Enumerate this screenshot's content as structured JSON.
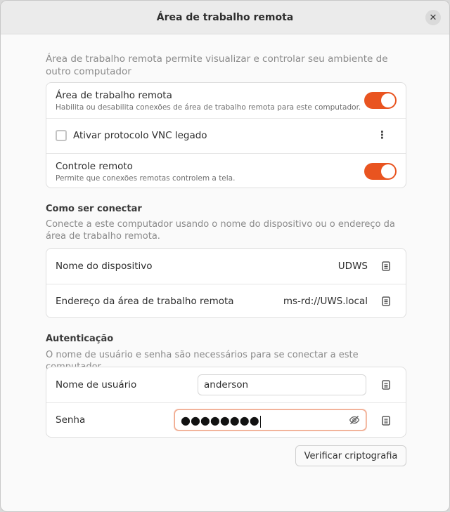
{
  "window": {
    "title": "Área de trabalho remota"
  },
  "intro": "Área de trabalho remota permite visualizar e controlar seu ambiente de outro computador",
  "settings": {
    "remote_desktop": {
      "title": "Área de trabalho remota",
      "subtitle": "Habilita ou desabilita conexões de área de trabalho remota para este computador.",
      "enabled": true
    },
    "vnc": {
      "label": "Ativar protocolo VNC legado",
      "checked": false,
      "menu_icon": "kebab-menu-icon"
    },
    "remote_control": {
      "title": "Controle remoto",
      "subtitle": "Permite que conexões remotas controlem a tela.",
      "enabled": true
    }
  },
  "connect": {
    "title": "Como ser conectar",
    "description": "Conecte a este computador usando o nome do dispositivo ou o endereço da área de trabalho remota.",
    "device_name_label": "Nome do dispositivo",
    "device_name_value": "UDWS",
    "address_label": "Endereço da área de trabalho remota",
    "address_value": "ms-rd://UWS.local"
  },
  "auth": {
    "title": "Autenticação",
    "description": "O nome de usuário e senha são necessários para se conectar a este computador.",
    "username_label": "Nome de usuário",
    "username_value": "anderson",
    "password_label": "Senha",
    "password_masked": "●●●●●●●●"
  },
  "verify_button": "Verificar criptografia",
  "colors": {
    "accent": "#e95420",
    "focus_border": "#f0a78a"
  }
}
